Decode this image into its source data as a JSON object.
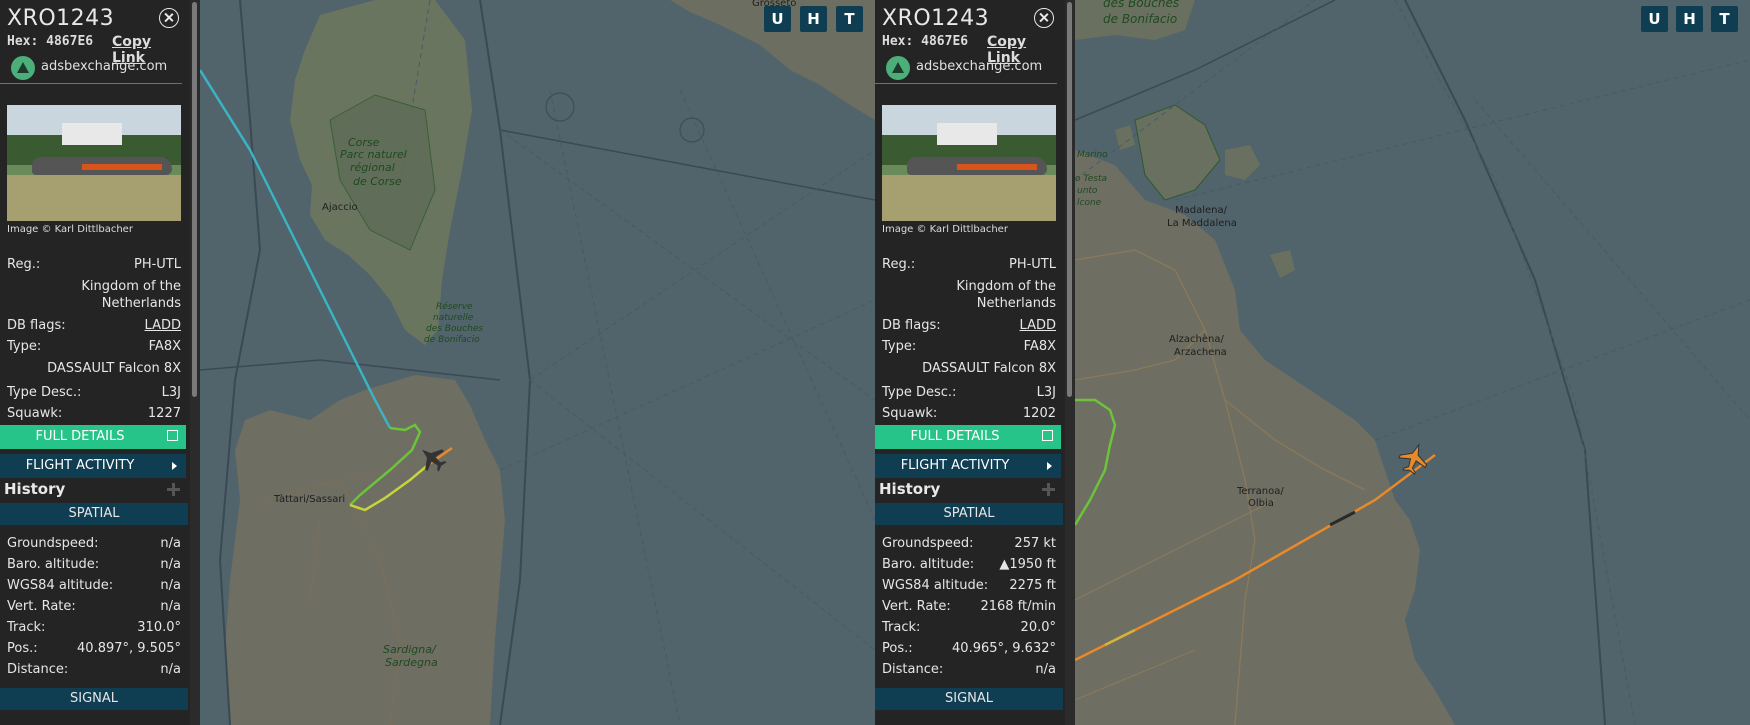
{
  "panels": [
    {
      "callsign": "XRO1243",
      "hex_label": "Hex: 4867E6",
      "copy_link": "Copy Link",
      "source": "adsbexchange.com",
      "photo_credit": "Image © Karl Dittlbacher",
      "reg_label": "Reg.:",
      "reg_value": "PH-UTL",
      "country_line1": "Kingdom of the",
      "country_line2": "Netherlands",
      "dbflags_label": "DB flags:",
      "dbflags_value": "LADD",
      "type_label": "Type:",
      "type_value": "FA8X",
      "model": "DASSAULT Falcon 8X",
      "typedesc_label": "Type Desc.:",
      "typedesc_value": "L3J",
      "squawk_label": "Squawk:",
      "squawk_value": "1227",
      "full_details": "FULL DETAILS",
      "flight_activity": "FLIGHT ACTIVITY",
      "history": "History",
      "spatial": "SPATIAL",
      "groundspeed_label": "Groundspeed:",
      "groundspeed_value": "n/a",
      "baro_label": "Baro. altitude:",
      "baro_value": "n/a",
      "wgs_label": "WGS84 altitude:",
      "wgs_value": "n/a",
      "vert_label": "Vert. Rate:",
      "vert_value": "n/a",
      "track_label": "Track:",
      "track_value": "310.0°",
      "pos_label": "Pos.:",
      "pos_value": "40.897°, 9.505°",
      "distance_label": "Distance:",
      "distance_value": "n/a",
      "signal": "SIGNAL",
      "map_labels": {
        "corse": "Corse",
        "parc1": "Parc naturel",
        "parc2": "régional",
        "parc3": "de Corse",
        "ajaccio": "Ajaccio",
        "reserve1": "Réserve",
        "reserve2": "naturelle",
        "reserve3": "des Bouches",
        "reserve4": "de Bonifacio",
        "tattari": "Tàttari/Sassari",
        "sardigna1": "Sardigna/",
        "sardigna2": "Sardegna",
        "grosseto": "Grosseto"
      }
    },
    {
      "callsign": "XRO1243",
      "hex_label": "Hex: 4867E6",
      "copy_link": "Copy Link",
      "source": "adsbexchange.com",
      "photo_credit": "Image © Karl Dittlbacher",
      "reg_label": "Reg.:",
      "reg_value": "PH-UTL",
      "country_line1": "Kingdom of the",
      "country_line2": "Netherlands",
      "dbflags_label": "DB flags:",
      "dbflags_value": "LADD",
      "type_label": "Type:",
      "type_value": "FA8X",
      "model": "DASSAULT Falcon 8X",
      "typedesc_label": "Type Desc.:",
      "typedesc_value": "L3J",
      "squawk_label": "Squawk:",
      "squawk_value": "1202",
      "full_details": "FULL DETAILS",
      "flight_activity": "FLIGHT ACTIVITY",
      "history": "History",
      "spatial": "SPATIAL",
      "groundspeed_label": "Groundspeed:",
      "groundspeed_value": "257 kt",
      "baro_label": "Baro. altitude:",
      "baro_value": "▲1950 ft",
      "wgs_label": "WGS84 altitude:",
      "wgs_value": "2275 ft",
      "vert_label": "Vert. Rate:",
      "vert_value": "2168 ft/min",
      "track_label": "Track:",
      "track_value": "20.0°",
      "pos_label": "Pos.:",
      "pos_value": "40.965°, 9.632°",
      "distance_label": "Distance:",
      "distance_value": "n/a",
      "signal": "SIGNAL",
      "map_labels": {
        "bouches1": "des Bouches",
        "bouches2": "de Bonifacio",
        "madalena1": "Madalena/",
        "madalena2": "La Maddalena",
        "alzachena1": "Alzachèna/",
        "alzachena2": "Arzachena",
        "terranoa1": "Terranoa/",
        "terranoa2": "Olbia",
        "marino1": "Marino",
        "marino2": "o Testa",
        "marino3": "unto",
        "marino4": "lcone"
      }
    }
  ],
  "layer_buttons": [
    "U",
    "H",
    "T"
  ]
}
